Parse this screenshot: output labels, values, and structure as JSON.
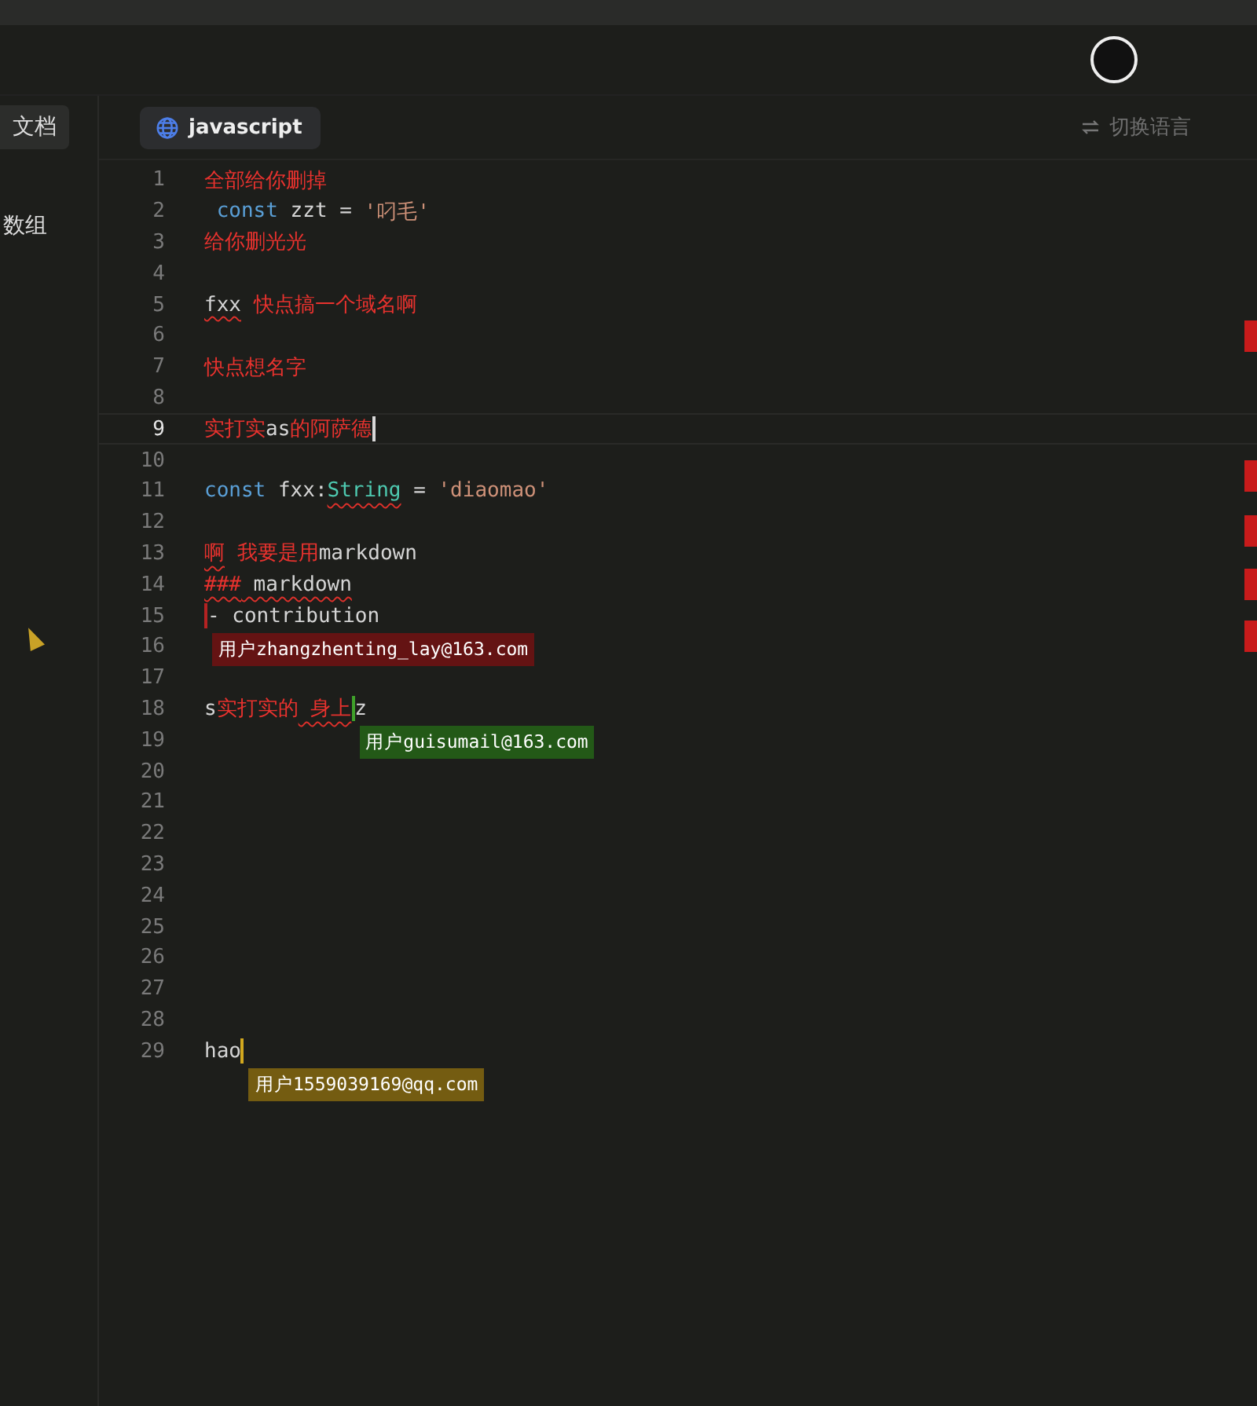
{
  "sidebar": {
    "tab": {
      "label": "文档",
      "selected": true
    },
    "items": [
      {
        "label": "数组"
      }
    ]
  },
  "editor_tab": {
    "label": "javascript",
    "selected": true
  },
  "switch_language": {
    "label": "切换语言"
  },
  "lines": [
    {
      "number": "1",
      "active": false,
      "tokens": [
        {
          "kind": "red",
          "text": "全部给你删掉"
        }
      ]
    },
    {
      "number": "2",
      "active": false,
      "tokens": [
        {
          "kind": "keyword",
          "text": " const"
        },
        {
          "kind": "plain",
          "text": " zzt = "
        },
        {
          "kind": "string",
          "text": "'叼毛'"
        }
      ]
    },
    {
      "number": "3",
      "active": false,
      "tokens": [
        {
          "kind": "red",
          "text": "给你删光光"
        }
      ]
    },
    {
      "number": "4",
      "active": false
    },
    {
      "number": "5",
      "active": false,
      "tokens": [
        {
          "kind": "plain",
          "text": "fxx",
          "squiggle": true
        },
        {
          "kind": "red",
          "text": " 快点搞一个域名啊"
        }
      ]
    },
    {
      "number": "6",
      "active": false
    },
    {
      "number": "7",
      "active": false,
      "tokens": [
        {
          "kind": "red",
          "text": "快点想名字"
        }
      ]
    },
    {
      "number": "8",
      "active": false
    },
    {
      "number": "9",
      "active": true,
      "tokens": [
        {
          "kind": "red",
          "text": "实打实"
        },
        {
          "kind": "plain",
          "text": "as"
        },
        {
          "kind": "red",
          "text": "的阿萨德"
        },
        {
          "kind": "cursor"
        }
      ],
      "cursor": {
        "color": "#d8d8d8"
      }
    },
    {
      "number": "10",
      "active": false
    },
    {
      "number": "11",
      "active": false,
      "tokens": [
        {
          "kind": "keyword",
          "text": "const"
        },
        {
          "kind": "plain",
          "text": " fxx:"
        },
        {
          "kind": "type",
          "text": "String",
          "squiggle": true
        },
        {
          "kind": "plain",
          "text": " = "
        },
        {
          "kind": "string",
          "text": "'diaomao'"
        }
      ]
    },
    {
      "number": "12",
      "active": false
    },
    {
      "number": "13",
      "active": false,
      "tokens": [
        {
          "kind": "red",
          "text": "啊",
          "squiggle": true
        },
        {
          "kind": "red",
          "text": " 我要是用"
        },
        {
          "kind": "plain",
          "text": "markdown"
        }
      ]
    },
    {
      "number": "14",
      "active": false,
      "tokens": [
        {
          "kind": "red",
          "text": "###",
          "squiggle": true
        },
        {
          "kind": "plain",
          "text": " markdown",
          "squiggle": true
        }
      ]
    },
    {
      "number": "15",
      "active": false,
      "tokens": [
        {
          "kind": "cursor"
        },
        {
          "kind": "plain",
          "text": "- contribution"
        }
      ],
      "cursor": {
        "color": "#b52222",
        "label": "用户zhangzhenting_lay@163.com"
      }
    },
    {
      "number": "16",
      "active": false
    },
    {
      "number": "17",
      "active": false
    },
    {
      "number": "18",
      "active": false,
      "tokens": [
        {
          "kind": "plain",
          "text": "s"
        },
        {
          "kind": "red",
          "text": "实打实的"
        },
        {
          "kind": "red",
          "text": " 身上",
          "squiggle": true
        },
        {
          "kind": "cursor"
        },
        {
          "kind": "plain",
          "text": "z"
        }
      ],
      "cursor": {
        "color": "#3fa12a",
        "label": "用户guisumail@163.com"
      }
    },
    {
      "number": "19",
      "active": false
    },
    {
      "number": "20",
      "active": false
    },
    {
      "number": "21",
      "active": false
    },
    {
      "number": "22",
      "active": false
    },
    {
      "number": "23",
      "active": false
    },
    {
      "number": "24",
      "active": false
    },
    {
      "number": "25",
      "active": false
    },
    {
      "number": "26",
      "active": false
    },
    {
      "number": "27",
      "active": false
    },
    {
      "number": "28",
      "active": false
    },
    {
      "number": "29",
      "active": false,
      "tokens": [
        {
          "kind": "plain",
          "text": "hao"
        },
        {
          "kind": "cursor"
        }
      ],
      "cursor": {
        "color": "#d2a81e",
        "label": "用户1559039169@qq.com"
      }
    }
  ]
}
